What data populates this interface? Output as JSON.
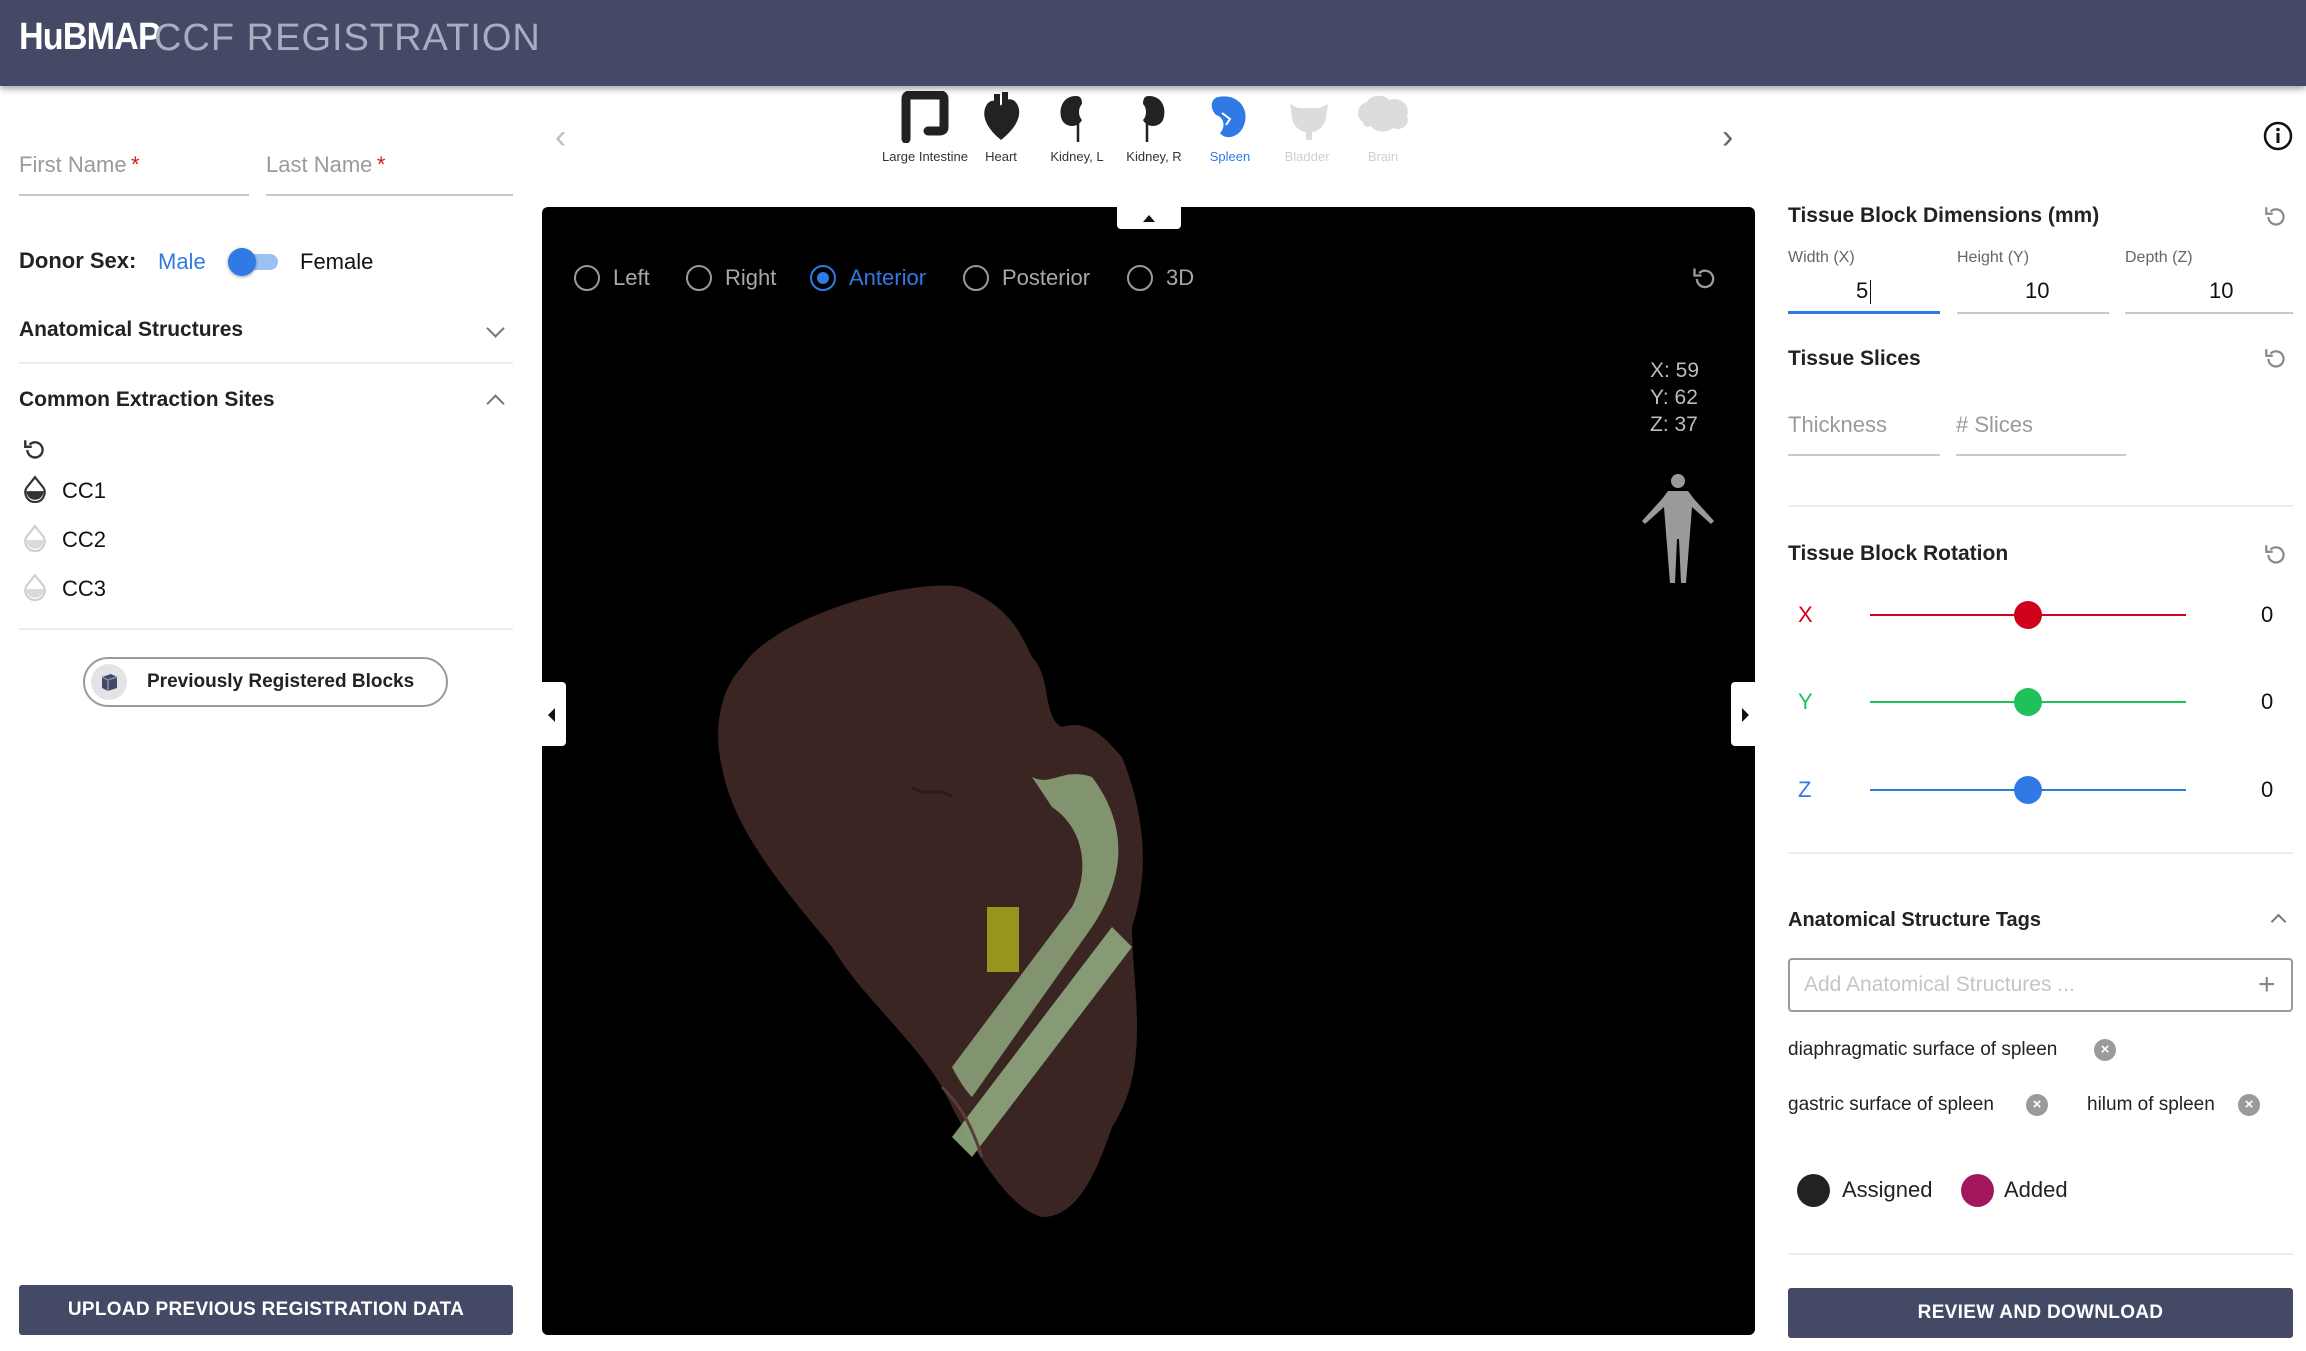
{
  "header": {
    "brand": "HuBMAP",
    "title": "CCF REGISTRATION"
  },
  "left": {
    "first_name_placeholder": "First Name",
    "last_name_placeholder": "Last Name",
    "required_mark": "*",
    "donor_sex_label": "Donor Sex:",
    "sex_male": "Male",
    "sex_female": "Female",
    "anatomical_structures": "Anatomical Structures",
    "common_extraction_sites": "Common Extraction Sites",
    "extraction_sites": [
      {
        "label": "CC1",
        "active": true
      },
      {
        "label": "CC2",
        "active": false
      },
      {
        "label": "CC3",
        "active": false
      }
    ],
    "previously_registered": "Previously Registered Blocks",
    "upload_button": "UPLOAD PREVIOUS REGISTRATION DATA"
  },
  "organs": [
    {
      "label": "Large Intestine",
      "state": "normal"
    },
    {
      "label": "Heart",
      "state": "normal"
    },
    {
      "label": "Kidney, L",
      "state": "normal"
    },
    {
      "label": "Kidney, R",
      "state": "normal"
    },
    {
      "label": "Spleen",
      "state": "active"
    },
    {
      "label": "Bladder",
      "state": "disabled"
    },
    {
      "label": "Brain",
      "state": "disabled"
    }
  ],
  "viewer": {
    "views": [
      {
        "label": "Left",
        "selected": false
      },
      {
        "label": "Right",
        "selected": false
      },
      {
        "label": "Anterior",
        "selected": true
      },
      {
        "label": "Posterior",
        "selected": false
      },
      {
        "label": "3D",
        "selected": false
      }
    ],
    "coords": {
      "x": "X: 59",
      "y": "Y: 62",
      "z": "Z: 37"
    }
  },
  "right": {
    "dimensions_title": "Tissue Block Dimensions (mm)",
    "width_label": "Width (X)",
    "width_value": "5",
    "height_label": "Height (Y)",
    "height_value": "10",
    "depth_label": "Depth (Z)",
    "depth_value": "10",
    "slices_title": "Tissue Slices",
    "thickness_placeholder": "Thickness",
    "slices_placeholder": "# Slices",
    "rotation_title": "Tissue Block Rotation",
    "rotation": [
      {
        "axis": "X",
        "value": "0",
        "color": "#d0021b"
      },
      {
        "axis": "Y",
        "value": "0",
        "color": "#1fc25a"
      },
      {
        "axis": "Z",
        "value": "0",
        "color": "#2f7ae5"
      }
    ],
    "tags_title": "Anatomical Structure Tags",
    "tags_placeholder": "Add Anatomical Structures ...",
    "tags": [
      "diaphragmatic surface of spleen",
      "gastric surface of spleen",
      "hilum of spleen"
    ],
    "legend_assigned": "Assigned",
    "legend_added": "Added",
    "assigned_color": "#222222",
    "added_color": "#a3175f",
    "review_button": "REVIEW AND DOWNLOAD"
  },
  "colors": {
    "header": "#444a65",
    "accent": "#2f7ae5"
  }
}
